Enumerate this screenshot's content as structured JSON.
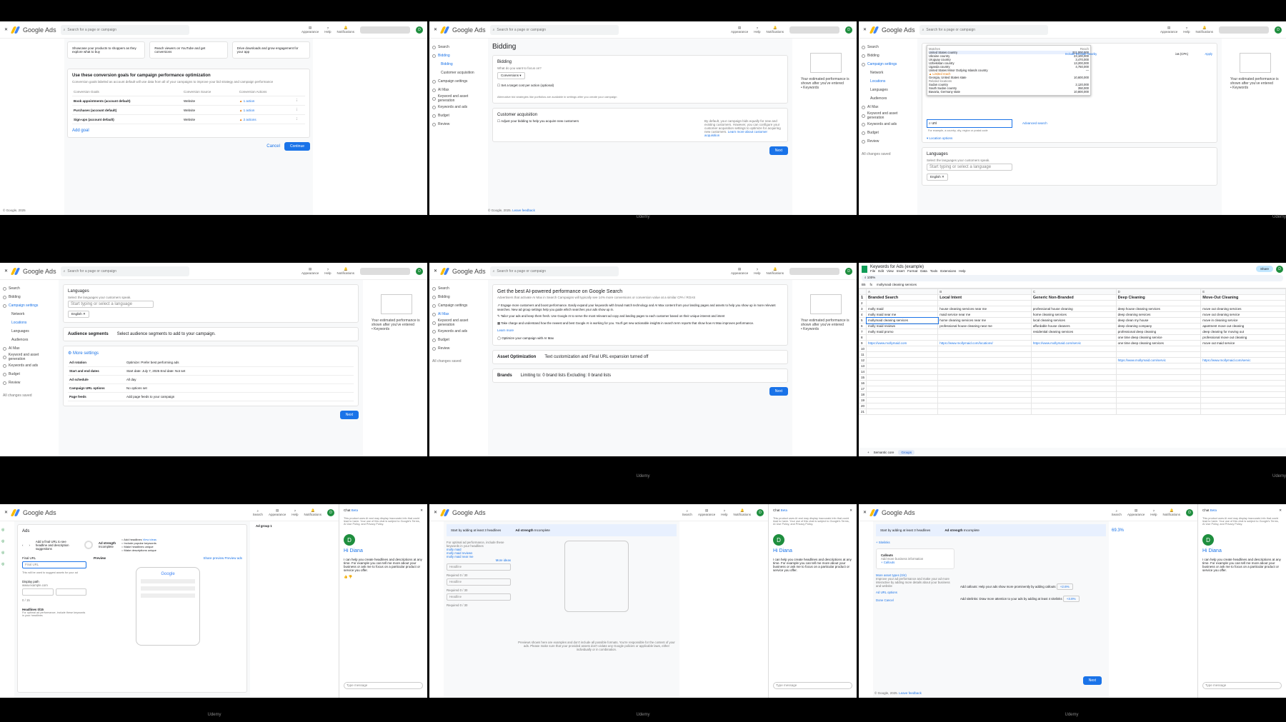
{
  "common": {
    "app_name": "Google Ads",
    "search_placeholder": "Search for a page or campaign",
    "header_items": [
      "Appearance",
      "Help",
      "Notifications"
    ],
    "header_items_search": [
      "Search",
      "Appearance",
      "Help",
      "Notifications"
    ],
    "avatar": "D",
    "footer": "© Google, 2025.",
    "footer_link": "Leave feedback",
    "watermark": "Udemy",
    "next": "Next",
    "estimate": "Your estimated performance is shown after you've entered",
    "estimate_bullet": "• Keywords"
  },
  "sidebar": [
    "Search",
    "Bidding",
    "Campaign settings",
    "AI Max",
    "Keyword and asset generation",
    "Keywords and ads",
    "Budget",
    "Review"
  ],
  "p1": {
    "goals_top": [
      "Showcase your products to shoppers as they explore what to buy",
      "Reach viewers on YouTube and get conversions",
      "Drive downloads and grow engagement for your app"
    ],
    "title": "Use these conversion goals for campaign performance optimization",
    "desc": "Conversion goals labeled as account default will use data from all of your campaigns to improve your bid strategy and campaign performance",
    "cols": [
      "Conversion Goals",
      "Conversion Source",
      "Conversion Actions"
    ],
    "rows": [
      {
        "goal": "Book appointments (account default)",
        "source": "Website",
        "action": "1 action"
      },
      {
        "goal": "Purchases (account default)",
        "source": "Website",
        "action": "1 action"
      },
      {
        "goal": "Sign-ups (account default)",
        "source": "Website",
        "action": "2 actions"
      }
    ],
    "add_goal": "Add goal",
    "cancel": "Cancel",
    "continue": "Continue",
    "footer": "© Google, 2025"
  },
  "p2": {
    "title": "Bidding",
    "card1": "Bidding",
    "q": "What do you want to focus on?",
    "select": "Conversions",
    "check": "Set a target cost per action (optional)",
    "alt": "Alternative bid strategies like portfolios are available in settings after you create your campaign",
    "card2": "Customer acquisition",
    "check2": "Adjust your bidding to help you acquire new customers",
    "note": "By default, your campaign bids equally for new and existing customers. However, you can configure your customer acquisition settings to optimize for acquiring new customers.",
    "learn": "Learn more about customer acquisition",
    "side_sub": [
      "Bidding",
      "Customer acquisition"
    ]
  },
  "p3": {
    "side_sub": [
      "Network",
      "Locations",
      "Languages",
      "Audiences"
    ],
    "drop_head": [
      "Matches",
      "Reach"
    ],
    "drop_rows": [
      {
        "name": "United States country",
        "reach": "311,000,000"
      },
      {
        "name": "Ukraine country",
        "reach": "23,100,000"
      },
      {
        "name": "Uruguay country",
        "reach": "3,470,000"
      },
      {
        "name": "Uzbekistan country",
        "reach": "13,200,000"
      },
      {
        "name": "Uganda country",
        "reach": "4,750,000"
      },
      {
        "name": "United States Minor Outlying Islands country",
        "reach": "—"
      },
      {
        "name": "Georgia, United States state",
        "reach": "10,600,000"
      },
      {
        "name": "Related locations",
        "reach": ""
      },
      {
        "name": "Sudan country",
        "reach": "2,120,000"
      },
      {
        "name": "South Sudan country",
        "reach": "350,000"
      },
      {
        "name": "Bavaria, Germany state",
        "reach": "10,800,000"
      }
    ],
    "limited": "Limited reach",
    "actions": [
      "Include",
      "Exclude",
      "Nearby"
    ],
    "cpa": "ias (CPA)",
    "apply": "Apply",
    "query": "uni",
    "hint": "For example, a country, city, region or postal code",
    "adv": "Advanced search",
    "loc_opts": "Location options",
    "lang_title": "Languages",
    "lang_desc": "Select the languages your customers speak.",
    "lang_ph": "Start typing or select a language",
    "english": "English",
    "saved": "All changes saved"
  },
  "p4": {
    "lang_title": "Languages",
    "lang_desc": "Select the languages your customers speak.",
    "lang_ph": "Start typing or select a language",
    "english": "English",
    "aud": "Audience segments",
    "aud_desc": "Select audience segments to add to your campaign.",
    "more": "More settings",
    "settings": [
      {
        "k": "Ad rotation",
        "v": "Optimize: Prefer best performing ads"
      },
      {
        "k": "Start and end dates",
        "v": "Start date: July 7, 2025    End date: Not set"
      },
      {
        "k": "Ad schedule",
        "v": "All day"
      },
      {
        "k": "Campaign URL options",
        "v": "No options set"
      },
      {
        "k": "Page feeds",
        "v": "Add page feeds to your campaign"
      }
    ],
    "side_sub": [
      "Network",
      "Locations",
      "Languages",
      "Audiences"
    ]
  },
  "p5": {
    "title": "Get the best AI-powered performance on Google Search",
    "desc": "Advertisers that activate AI Max in Search Campaigns will typically see 14% more conversions or conversion value at a similar CPA / ROAS",
    "bullets": [
      "Engage more customers and boost performance. Easily expand your keywords with broad match technology and AI Max content from your landing pages and assets to help you show up in more relevant searches. New ad group settings help you guide which searches your ads show up in.",
      "Tailor your ads and keep them fresh. Use Google AI to serve the most relevant ad copy and landing pages to each customer based on their unique interest and intent",
      "Take charge and understand how the newest and best Google AI is working for you. You'll get new actionable insights in search term reports that show how AI Max improves performance."
    ],
    "learn": "Learn more",
    "toggle": "Optimize your campaign with AI Max",
    "asset": "Asset Optimization",
    "asset_v": "Text customization and Final URL expansion turned off",
    "brands": "Brands",
    "brands_v": "Limiting to: 0 brand lists  Excluding: 0 brand lists"
  },
  "p6": {
    "title": "Keywords for Ads (example)",
    "menus": [
      "File",
      "Edit",
      "View",
      "Insert",
      "Format",
      "Data",
      "Tools",
      "Extensions",
      "Help"
    ],
    "share": "Share",
    "cell": "B5",
    "formula": "mollymaid cleaning services",
    "zoom": "100%",
    "cols": [
      "A",
      "B",
      "C",
      "D",
      "E",
      "F",
      "G",
      "H",
      "I",
      "J",
      "K",
      "L",
      "M"
    ],
    "headers": [
      "Branded Search",
      "Local Intent",
      "Generic Non-Branded",
      "Deep Cleaning",
      "Move-Out Cleaning"
    ],
    "rows": [
      [
        "molly maid",
        "house cleaning services near me",
        "professional house cleaning",
        "deep house cleaning services",
        "move out cleaning services"
      ],
      [
        "molly maid near me",
        "maid service near me",
        "home cleaning services",
        "deep cleaning services",
        "move out cleaning service"
      ],
      [
        "mollymaid cleaning services",
        "home cleaning services near me",
        "local cleaning services",
        "deep clean my house",
        "move in cleaning service"
      ],
      [
        "molly maid reviews",
        "professional house cleaning near me",
        "affordable house cleaners",
        "deep cleaning company",
        "apartment move out cleaning"
      ],
      [
        "molly maid promo",
        "",
        "residential cleaning services",
        "professional deep cleaning",
        "deep cleaning for moving out"
      ],
      [
        "",
        "",
        "",
        "one time deep cleaning service",
        "professional move out cleaning"
      ],
      [
        "https://www.mollymaid.com",
        "https://www.mollymaid.com/locations/",
        "https://www.mollymaid.com/servic",
        "one time deep cleaning services",
        "move out maid service"
      ],
      [
        "",
        "",
        "",
        "https://www.mollymaid.com/servic",
        "https://www.mollymaid.com/servic"
      ]
    ],
    "tabs": [
      "Semantic core",
      "Groups"
    ]
  },
  "p7": {
    "ads": "Ads",
    "final_tip": "Add a final URL to see headline and description suggestions",
    "strength": "Ad strength",
    "incomplete": "Incomplete",
    "checks": [
      "Add headlines",
      "Include popular keywords",
      "Make headlines unique",
      "Make descriptions unique"
    ],
    "view": "View ideas",
    "final": "Final URL",
    "final_ph": "Final URL",
    "final_hint": "This will be used to suggest assets for your ad",
    "display": "Display path",
    "dp": "www.example.com",
    "cnt": "0 / 15",
    "preview": "Preview",
    "share_prev": "Share preview",
    "prev_ads": "Preview ads",
    "gword": "Google",
    "headlines": "Headlines 0/15",
    "hl_tip": "For optimal ad performance, include these keywords in your headlines",
    "adgroup": "Ad group 1"
  },
  "chat": {
    "title": "Chat",
    "beta": "Beta",
    "disclaimer": "This product uses AI and may display inaccurate info that could lead to harm. Your use of this chat is subject to Google's Terms, AI Use Policy, and Privacy Policy.",
    "hi": "Hi Diana",
    "body": "I can help you create headlines and descriptions at any time. For example you can tell me more about your business or ask me to focus on a particular product or service you offer.",
    "placeholder": "Type message"
  },
  "p8": {
    "start": "Start by adding at least 3 headlines",
    "kw": [
      "molly maid",
      "molly maid reviews",
      "molly maid near me"
    ],
    "more_ideas": "More ideas",
    "hl": "Headline",
    "req": "Required",
    "cnt": "0 / 30",
    "note": "Previews shown here are examples and don't include all possible formats. You're responsible for the content of your ads. Please make sure that your provided assets don't violate any Google policies or applicable laws, either individually or in combination."
  },
  "p9": {
    "sitelinks": "Sitelinks",
    "callouts": "Callouts",
    "callout_tip": "Add more business information",
    "more_assets": "More asset types (0/4)",
    "more_desc": "Improve your ad performance and make your ad more interactive by adding more details about your business and website",
    "url_opts": "Ad URL options",
    "done": "Done",
    "cancel": "Cancel",
    "add_callouts": "Add callouts: Help your ads show more prominently by adding callouts",
    "add_sitelinks": "Add sitelinks: Draw more attention to your ads by adding at least 4 sitelinks",
    "uplift": [
      "+2.6%",
      "+3.8%"
    ],
    "pct": "69.3%"
  }
}
